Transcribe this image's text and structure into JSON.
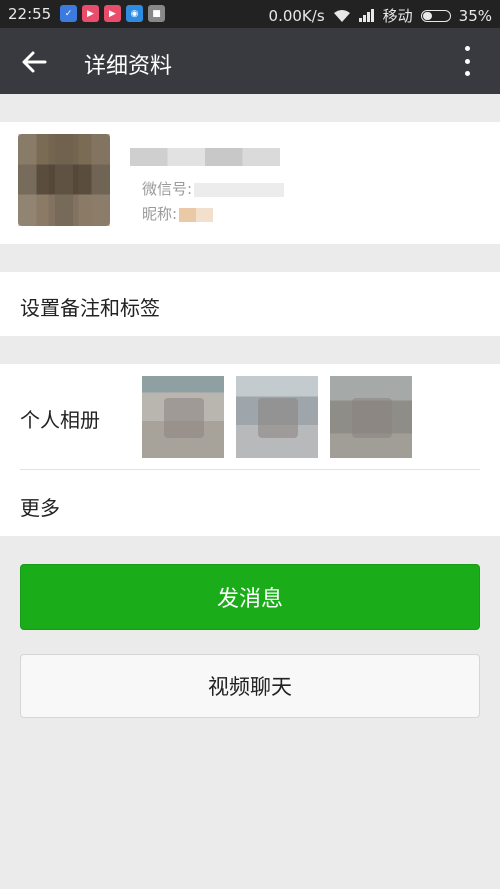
{
  "status_bar": {
    "time": "22:55",
    "network_speed": "0.00K/s",
    "carrier": "移动",
    "battery": "35%",
    "battery_level": 0.35,
    "icons": [
      "shield-icon",
      "play-icon",
      "play-icon",
      "browser-icon",
      "app-icon"
    ]
  },
  "app_bar": {
    "title": "详细资料"
  },
  "profile": {
    "wechat_id_label": "微信号:",
    "nickname_label": "昵称:"
  },
  "rows": {
    "remark_label": "设置备注和标签",
    "album_label": "个人相册",
    "more_label": "更多"
  },
  "buttons": {
    "message": "发消息",
    "video_chat": "视频聊天"
  },
  "colors": {
    "app_bar": "#393a3f",
    "status_bar": "#222222",
    "primary_green": "#1aad19",
    "background": "#ebebeb"
  }
}
